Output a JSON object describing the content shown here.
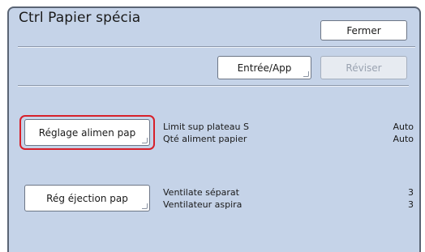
{
  "window": {
    "title": "Ctrl Papier spécia"
  },
  "toolbar": {
    "close_label": "Fermer",
    "entry_label": "Entrée/App",
    "revise_label": "Réviser"
  },
  "sections": [
    {
      "button_label": "Réglage alimen pap",
      "selected": true,
      "settings": [
        {
          "label": "Limit sup plateau S",
          "value": "Auto"
        },
        {
          "label": "Qté aliment papier",
          "value": "Auto"
        }
      ]
    },
    {
      "button_label": "Rég éjection pap",
      "selected": false,
      "settings": [
        {
          "label": "Ventilate séparat",
          "value": "3"
        },
        {
          "label": "Ventilateur aspira",
          "value": "3"
        }
      ]
    }
  ],
  "colors": {
    "panel_background": "#c5d3e8",
    "selection_highlight": "#d8202a",
    "disabled_text": "#9aa3b1"
  }
}
